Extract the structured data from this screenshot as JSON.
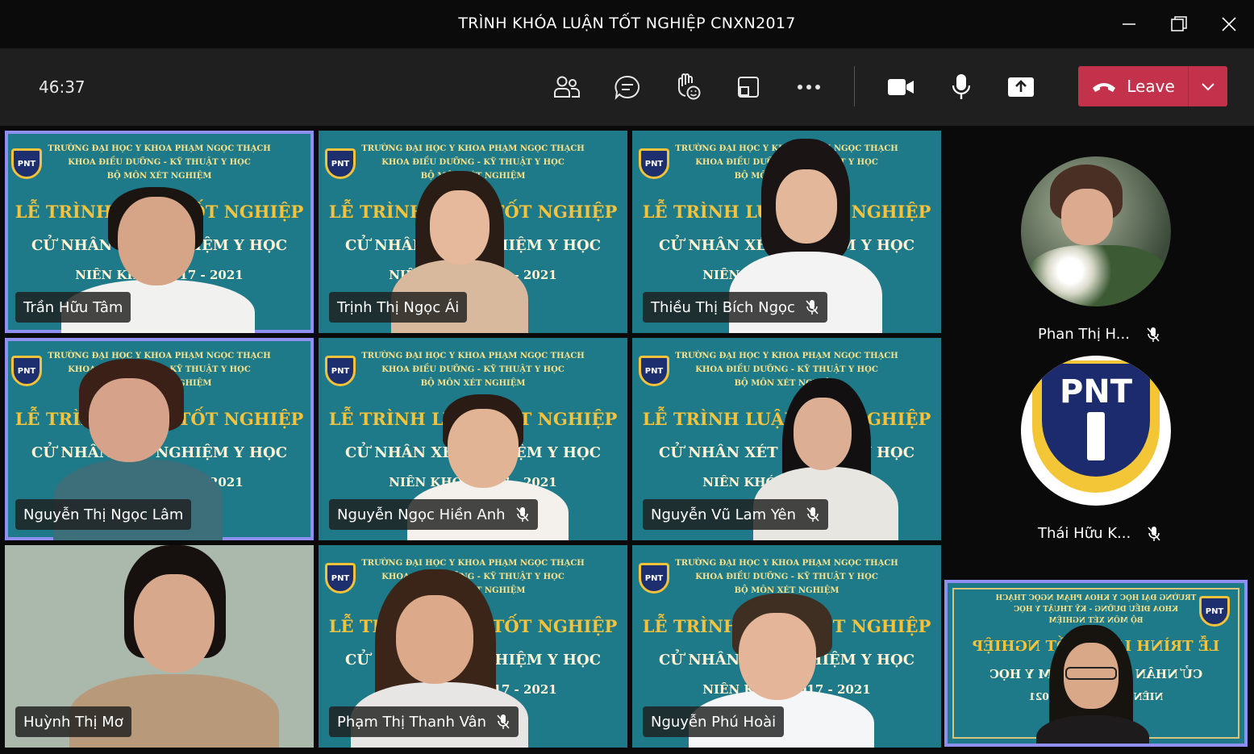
{
  "window": {
    "title": "TRÌNH KHÓA LUẬN TỐT NGHIỆP CNXN2017"
  },
  "toolbar": {
    "timer": "46:37",
    "leave_label": "Leave"
  },
  "slide": {
    "line1": "TRƯỜNG ĐẠI HỌC Y KHOA PHẠM NGỌC THẠCH",
    "line2": "KHOA ĐIỀU DƯỠNG - KỸ THUẬT Y HỌC",
    "line3": "BỘ MÔN XÉT NGHIỆM",
    "big": "LỄ TRÌNH LUẬN TỐT NGHIỆP",
    "mid": "CỬ NHÂN XÉT NGHIỆM Y HỌC",
    "bot": "NIÊN KHÓA 2017 - 2021",
    "logo_text": "PNT"
  },
  "tiles": [
    {
      "name": "Trần Hữu Tâm",
      "muted": false,
      "active": true
    },
    {
      "name": "Trịnh Thị Ngọc Ái",
      "muted": false,
      "active": false
    },
    {
      "name": "Thiều Thị Bích Ngọc",
      "muted": true,
      "active": false
    },
    {
      "name": "Nguyễn Thị Ngọc Lâm",
      "muted": false,
      "active": true
    },
    {
      "name": "Nguyễn Ngọc Hiền Anh",
      "muted": true,
      "active": false
    },
    {
      "name": "Nguyễn Vũ Lam Yên",
      "muted": true,
      "active": false
    },
    {
      "name": "Huỳnh Thị Mơ",
      "muted": false,
      "active": false
    },
    {
      "name": "Phạm Thị Thanh Vân",
      "muted": true,
      "active": false
    },
    {
      "name": "Nguyễn Phú Hoài",
      "muted": false,
      "active": false
    }
  ],
  "side": [
    {
      "name": "Phan Thị H...",
      "muted": true
    },
    {
      "name": "Thái Hữu K...",
      "muted": true
    }
  ],
  "pnt_logo": {
    "text": "PNT"
  },
  "colors": {
    "leave": "#c4314b",
    "active_outline": "#8f8ff2",
    "slide_bg": "#1e7a88"
  }
}
